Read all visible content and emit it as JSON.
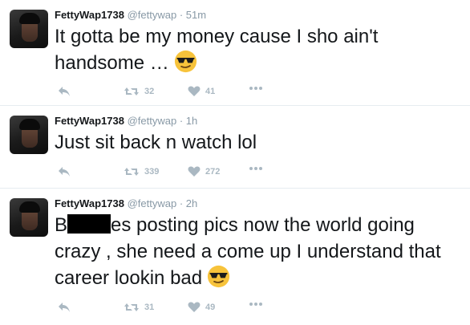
{
  "tweets": [
    {
      "name": "FettyWap1738",
      "handle": "@fettywap",
      "separator": "·",
      "time": "51m",
      "text_parts": [
        "It gotta be my money cause I sho ain't handsome …"
      ],
      "emoji": "sunglasses-emoji",
      "retweets": "32",
      "likes": "41"
    },
    {
      "name": "FettyWap1738",
      "handle": "@fettywap",
      "separator": "·",
      "time": "1h",
      "text_parts": [
        "Just sit back n watch lol"
      ],
      "retweets": "339",
      "likes": "272"
    },
    {
      "name": "FettyWap1738",
      "handle": "@fettywap",
      "separator": "·",
      "time": "2h",
      "text_parts": [
        "B",
        "es posting pics now the world going crazy , she need a come up I understand that career lookin bad"
      ],
      "emoji": "sunglasses-emoji",
      "retweets": "31",
      "likes": "49"
    }
  ],
  "colors": {
    "text": "#14171a",
    "muted": "#8899a6",
    "action": "#aab8c2",
    "divider": "#e6ecf0",
    "emoji": "#f7c33b"
  },
  "icons": [
    "reply-icon",
    "retweet-icon",
    "heart-icon",
    "more-icon"
  ]
}
